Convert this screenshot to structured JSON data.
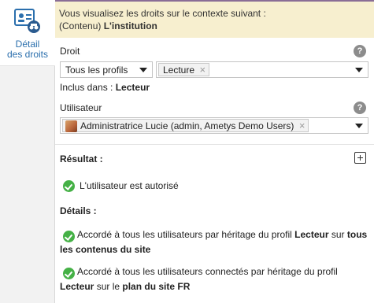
{
  "sidebar": {
    "tab_label_line1": "Détail",
    "tab_label_line2": "des droits",
    "icon": "rights-detail-icon"
  },
  "context": {
    "line1": "Vous visualisez les droits sur le contexte suivant :",
    "line2_prefix": "(Contenu)",
    "line2_bold": "L'institution"
  },
  "right": {
    "label": "Droit",
    "profiles_value": "Tous les profils",
    "tag": "Lecture",
    "included_prefix": "Inclus dans :",
    "included_bold": "Lecteur"
  },
  "user": {
    "label": "Utilisateur",
    "tag": "Administratrice Lucie (admin, Ametys Demo Users)"
  },
  "result": {
    "title": "Résultat :",
    "text": "L'utilisateur est autorisé"
  },
  "details": {
    "title": "Détails :",
    "items": [
      {
        "text1": "Accordé à tous les utilisateurs par héritage du profil",
        "bold1": "Lecteur",
        "text2": "sur",
        "bold2": "tous les contenus du site"
      },
      {
        "text1": "Accordé à tous les utilisateurs connectés par héritage du profil",
        "bold1": "Lecteur",
        "text2": "sur le",
        "bold2": "plan du site FR"
      }
    ]
  },
  "colors": {
    "banner_bg": "#f7efcf",
    "banner_border": "#8a6d96",
    "tab_label": "#2b6fad",
    "success": "#45b146"
  }
}
